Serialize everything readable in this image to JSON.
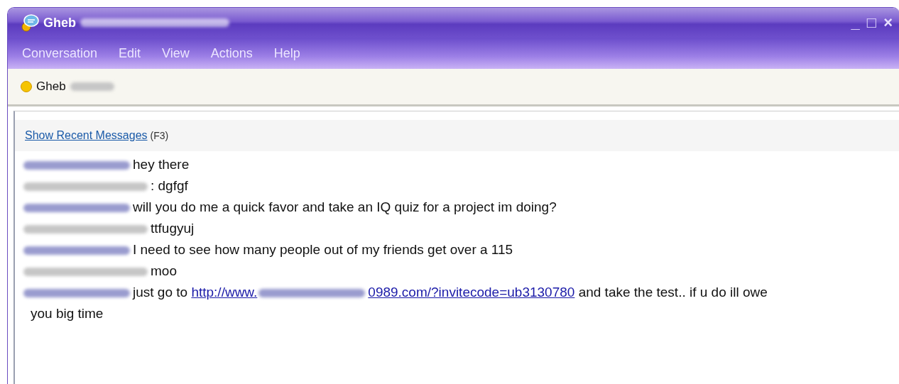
{
  "window": {
    "title": "Gheb",
    "title_redacted": true,
    "controls": [
      "_",
      "□",
      "×"
    ]
  },
  "menu": [
    {
      "label": "Conversation"
    },
    {
      "label": "Edit"
    },
    {
      "label": "View"
    },
    {
      "label": "Actions"
    },
    {
      "label": "Help"
    }
  ],
  "contact": {
    "name": "Gheb",
    "name_redacted": true,
    "color": "#f5c400"
  },
  "recent": {
    "link": "Show Recent Messages",
    "shortcut": "(F3)"
  },
  "messages": [
    {
      "kind": "contact",
      "text": "hey there"
    },
    {
      "kind": "self",
      "text": ": dgfgf"
    },
    {
      "kind": "contact",
      "text": "will you do me a quick favor and take an IQ quiz for a project im doing?"
    },
    {
      "kind": "self",
      "text": "ttfugyuj"
    },
    {
      "kind": "contact",
      "text": "I need to see how many people out of my friends get over a 115"
    },
    {
      "kind": "self",
      "text": "moo"
    },
    {
      "kind": "contact",
      "text": "just go to",
      "link_start": "http://www.",
      "link_end": "0989.com/?invitecode=ub3130780",
      "text_after": "and take the test.. if u do ill owe you big time"
    }
  ]
}
